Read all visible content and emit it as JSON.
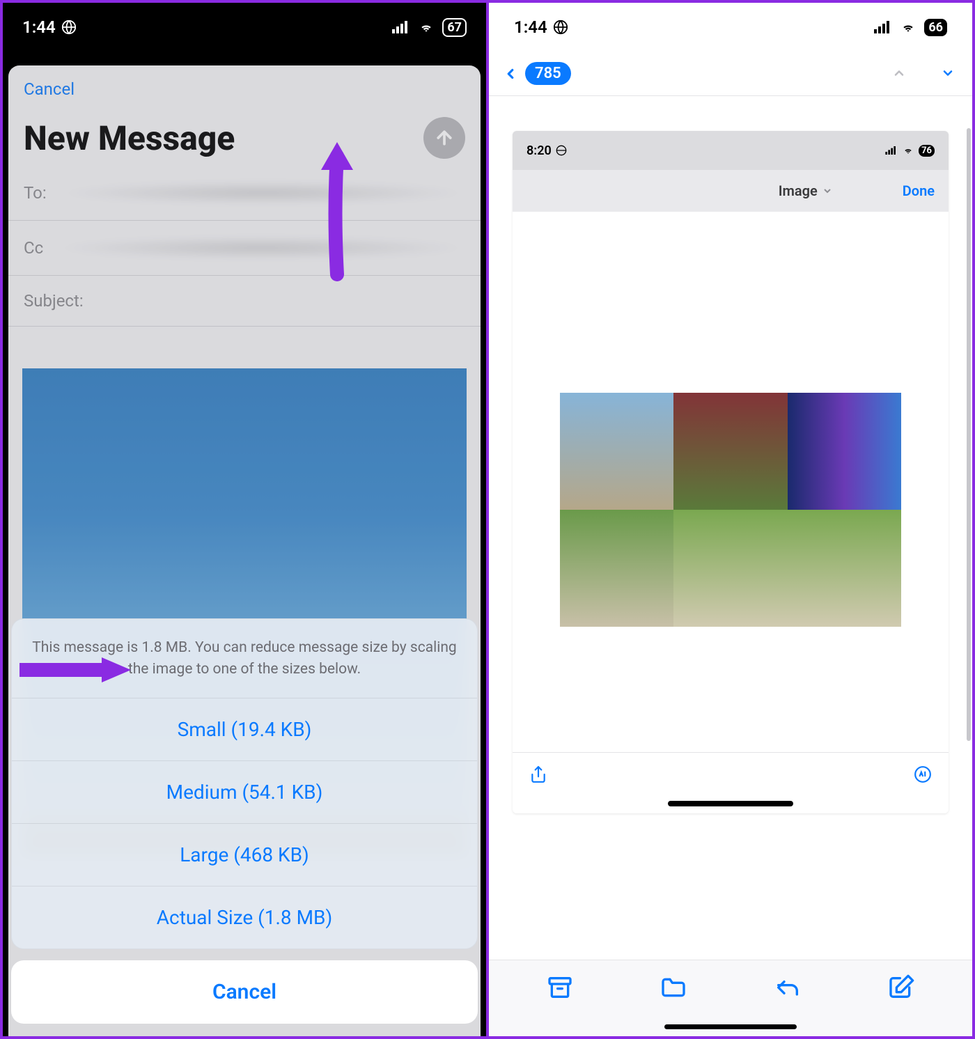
{
  "left": {
    "status": {
      "time": "1:44",
      "battery": "67"
    },
    "compose": {
      "cancel": "Cancel",
      "title": "New Message",
      "to_label": "To:",
      "cc_label": "Cc",
      "subject_label": "Subject:"
    },
    "sheet": {
      "message": "This message is 1.8 MB. You can reduce message size by scaling the image to one of the sizes below.",
      "options": [
        "Small (19.4 KB)",
        "Medium (54.1 KB)",
        "Large (468 KB)",
        "Actual Size (1.8 MB)"
      ],
      "cancel": "Cancel"
    }
  },
  "right": {
    "status": {
      "time": "1:44",
      "battery": "66"
    },
    "nav": {
      "count": "785"
    },
    "inner": {
      "time": "8:20",
      "battery": "76",
      "label": "Image",
      "done": "Done"
    }
  }
}
